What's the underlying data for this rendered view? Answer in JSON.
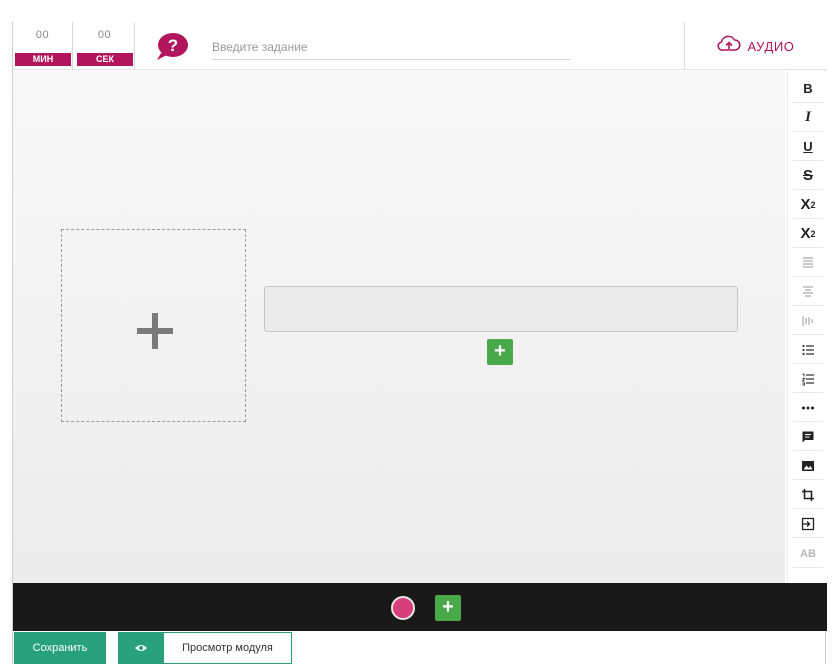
{
  "header": {
    "timer_minutes": "00",
    "timer_minutes_label": "МИН",
    "timer_seconds": "00",
    "timer_seconds_label": "СЕК",
    "task_placeholder": "Введите задание",
    "audio_label": "АУДИО"
  },
  "toolbar": {
    "bold": "B",
    "italic": "I",
    "underline": "U",
    "strike": "S",
    "superscript": "X",
    "superscript_mark": "2",
    "subscript": "X",
    "subscript_mark": "2",
    "ab": "AB"
  },
  "footer": {
    "save_label": "Сохранить",
    "preview_label": "Просмотр модуля"
  },
  "colors": {
    "brand": "#b3155d",
    "green": "#48a84a",
    "teal": "#27a17b",
    "record": "#d63f7b"
  }
}
